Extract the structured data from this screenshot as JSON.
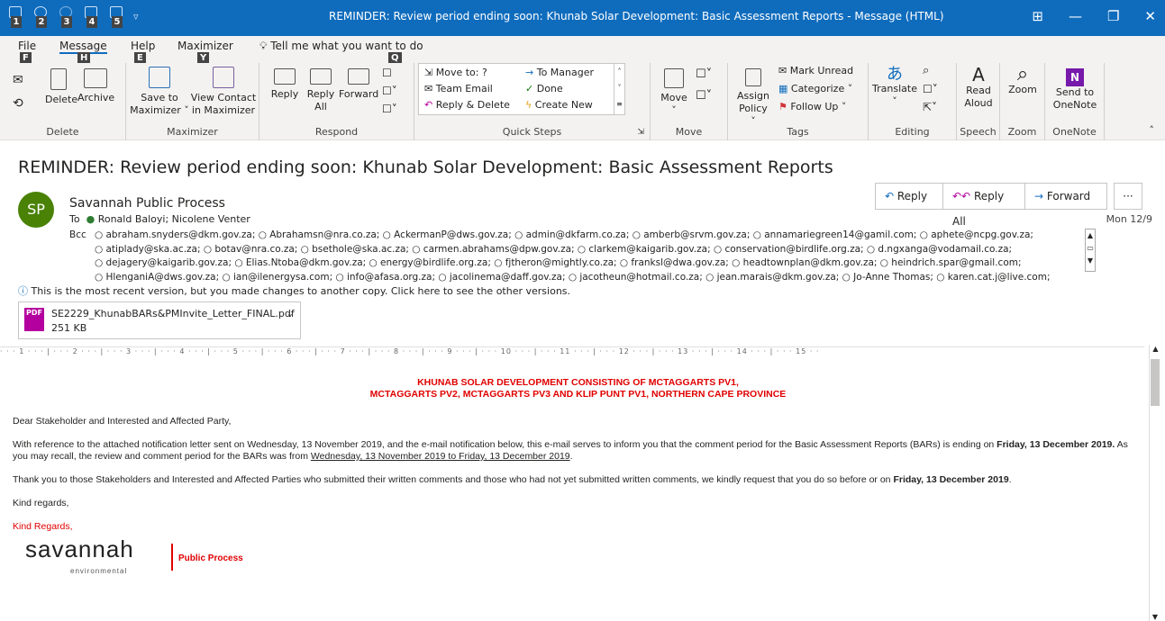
{
  "window": {
    "title": "REMINDER: Review period ending soon: Khunab Solar Development: Basic Assessment Reports  -  Message (HTML)",
    "qat_keys": [
      "1",
      "2",
      "3",
      "4",
      "5"
    ]
  },
  "tabs": [
    {
      "label": "File",
      "key": "F"
    },
    {
      "label": "Message",
      "key": "H"
    },
    {
      "label": "Help",
      "key": "E"
    },
    {
      "label": "Maximizer",
      "key": "Y"
    }
  ],
  "tell_me": {
    "text": "Tell me what you want to do",
    "key": "Q"
  },
  "groups": {
    "delete": "Delete",
    "maximizer": "Maximizer",
    "respond": "Respond",
    "quick_steps": "Quick Steps",
    "move": "Move",
    "tags": "Tags",
    "editing": "Editing",
    "speech": "Speech",
    "zoom": "Zoom",
    "onenote": "OneNote"
  },
  "buttons": {
    "delete": "Delete",
    "archive": "Archive",
    "save_to_max_1": "Save to",
    "save_to_max_2": "Maximizer ˅",
    "view_contact_1": "View Contact",
    "view_contact_2": "in Maximizer",
    "reply": "Reply",
    "reply_all_1": "Reply",
    "reply_all_2": "All",
    "forward": "Forward",
    "move_1": "Move",
    "move_2": "˅",
    "assign_1": "Assign",
    "assign_2": "Policy ˅",
    "mark_unread": "Mark Unread",
    "categorize": "Categorize ˅",
    "follow_up": "Follow Up ˅",
    "translate": "Translate",
    "read_aloud_1": "Read",
    "read_aloud_2": "Aloud",
    "zoom": "Zoom",
    "send_1": "Send to",
    "send_2": "OneNote"
  },
  "quick_steps": [
    "Move to: ?",
    "Team Email",
    "Reply & Delete",
    "To Manager",
    "Done",
    "Create New"
  ],
  "message": {
    "subject": "REMINDER: Review period ending soon: Khunab Solar Development: Basic Assessment Reports",
    "avatar": "SP",
    "sender": "Savannah Public Process",
    "reply": "Reply",
    "reply_all": "Reply All",
    "forward": "Forward",
    "more": "···",
    "to_label": "To",
    "to": "Ronald Baloyi; Nicolene Venter",
    "date": "Mon 12/9",
    "bcc_label": "Bcc",
    "bcc_lines": [
      "○ abraham.snyders@dkm.gov.za; ○ Abrahamsn@nra.co.za; ○ AckermanP@dws.gov.za; ○ admin@dkfarm.co.za; ○ amberb@srvm.gov.za; ○ annamariegreen14@gamil.com; ○ aphete@ncpg.gov.za;",
      "○ atiplady@ska.ac.za; ○ botav@nra.co.za; ○ bsethole@ska.ac.za; ○ carmen.abrahams@dpw.gov.za; ○ clarkem@kaigarib.gov.za; ○ conservation@birdlife.org.za; ○ d.ngxanga@vodamail.co.za;",
      "○ dejagery@kaigarib.gov.za; ○ Elias.Ntoba@dkm.gov.za; ○ energy@birdlife.org.za; ○ fjtheron@mightly.co.za; ○ franksl@dwa.gov.za; ○ headtownplan@dkm.gov.za; ○ heindrich.spar@gmail.com;",
      "○ HlenganiA@dws.gov.za; ○ ian@ilenergysa.com; ○ info@afasa.org.za; ○ jacolinema@daff.gov.za; ○ jacotheun@hotmail.co.za; ○ jean.marais@dkm.gov.za; ○ Jo-Anne Thomas; ○ karen.cat.j@live.com;"
    ],
    "info": "This is the most recent version, but you made changes to another copy. Click here to see the other versions.",
    "attachment": {
      "name": "SE2229_KhunabBARs&PMInvite_Letter_FINAL.pdf",
      "size": "251 KB",
      "icon_label": "PDF"
    }
  },
  "body": {
    "heading_1": "KHUNAB SOLAR DEVELOPMENT CONSISTING OF MCTAGGARTS PV1,",
    "heading_2": "MCTAGGARTS PV2, MCTAGGARTS PV3 AND KLIP PUNT PV1, NORTHERN CAPE PROVINCE",
    "greeting": "Dear Stakeholder and Interested and Affected Party,",
    "p1_a": "With reference to the attached notification letter sent on Wednesday, 13 November 2019, and the e-mail notification below, this e-mail serves to inform you that the comment period for the Basic Assessment Reports (BARs) is ending on ",
    "p1_b": "Friday, 13 December 2019.",
    "p1_c": "  As you may recall, the review and comment period for the BARs was from ",
    "p1_d": "Wednesday, 13 November 2019 to Friday, 13 December 2019",
    "p1_e": ".",
    "p2_a": "Thank you to those Stakeholders and Interested and Affected Parties who submitted their written comments and those who had not yet submitted written comments, we kindly request that you do so before or on ",
    "p2_b": "Friday, 13 December 2019",
    "p2_c": ".",
    "kind": "Kind regards,",
    "kind_red": "Kind Regards,",
    "logo_main": "savannah",
    "logo_sub": "environmental",
    "logo_tag": "Public Process"
  },
  "ruler": "·  ·  ·  1  ·  ·  ·  |  ·  ·  ·  2  ·  ·  ·  |  ·  ·  ·  3  ·  ·  ·  |  ·  ·  ·  4  ·  ·  ·  |  ·  ·  ·  5  ·  ·  ·  |  ·  ·  ·  6  ·  ·  ·  |  ·  ·  ·  7  ·  ·  ·  |  ·  ·  ·  8  ·  ·  ·  |  ·  ·  ·  9  ·  ·  ·  |  ·  ·  ·  10  ·  ·  ·  |  ·  ·  ·  11  ·  ·  ·  |  ·  ·  ·  12  ·  ·  ·  |  ·  ·  ·  13  ·  ·  ·  |  ·  ·  ·  14  ·  ·  ·  |  ·  ·  ·  15  ·  ·",
  "colors": {
    "accent": "#0f6cbd",
    "avatar": "#498205",
    "red": "#e00000",
    "green": "#2e7d32"
  }
}
